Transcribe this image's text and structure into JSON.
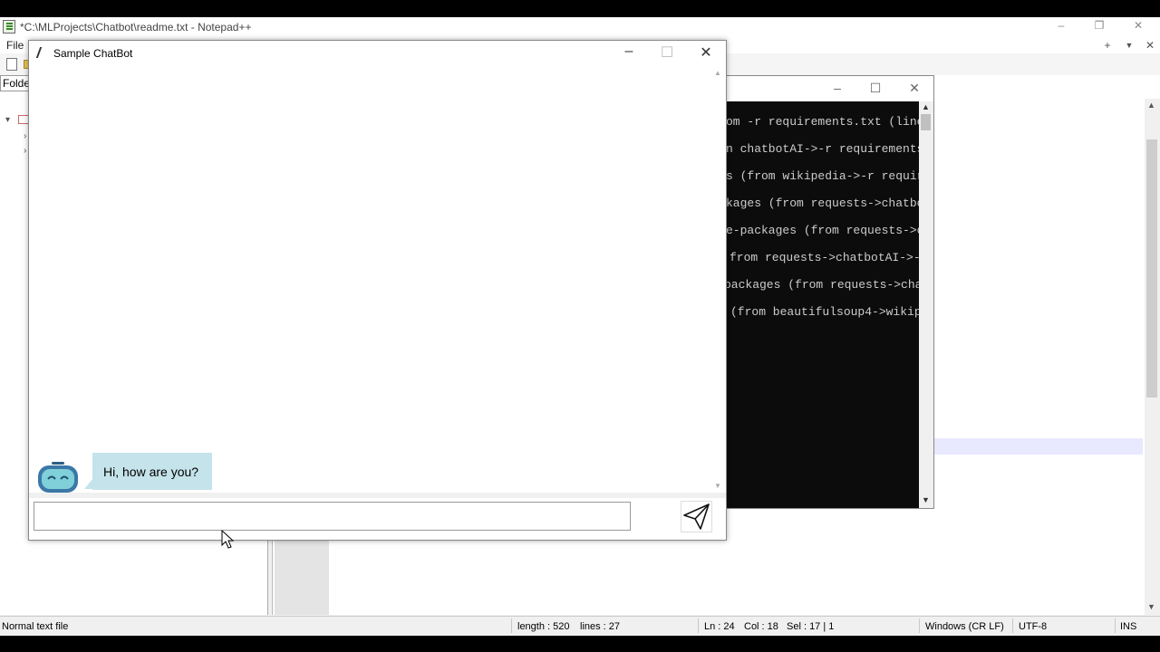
{
  "notepad": {
    "title": "*C:\\MLProjects\\Chatbot\\readme.txt - Notepad++",
    "menu_file": "File",
    "folder_label": "Folde",
    "window_buttons": {
      "minimize": "–",
      "restore": "❐",
      "close": "✕"
    },
    "mini_buttons": {
      "plus": "+",
      "dropdown": "▼",
      "close": "✕"
    },
    "status": {
      "file_type": "Normal text file",
      "length": "length : 520",
      "lines": "lines : 27",
      "ln": "Ln : 24",
      "col": "Col : 18",
      "sel": "Sel : 17 | 1",
      "eol": "Windows (CR LF)",
      "encoding": "UTF-8",
      "mode": "INS"
    }
  },
  "console": {
    "window_buttons": {
      "minimize": "–",
      "maximize": "☐",
      "close": "✕"
    },
    "lines": [
      "om -r requirements.txt (line",
      "n chatbotAI->-r requirements.",
      "s (from wikipedia->-r require",
      "kages (from requests->chatbot",
      "e-packages (from requests->c",
      "from requests->chatbotAI->-r",
      "packages (from requests->chat",
      "(from beautifulsoup4->wikipe"
    ]
  },
  "chatbot": {
    "title": "Sample ChatBot",
    "window_buttons": {
      "minimize": "–",
      "maximize": "☐",
      "close": "✕"
    },
    "messages": [
      {
        "sender": "bot",
        "text": "Hi, how are you?"
      }
    ],
    "input_value": "",
    "icons": {
      "send": "send-icon",
      "avatar": "robot-icon"
    },
    "colors": {
      "bubble": "#c5e3ea"
    }
  }
}
